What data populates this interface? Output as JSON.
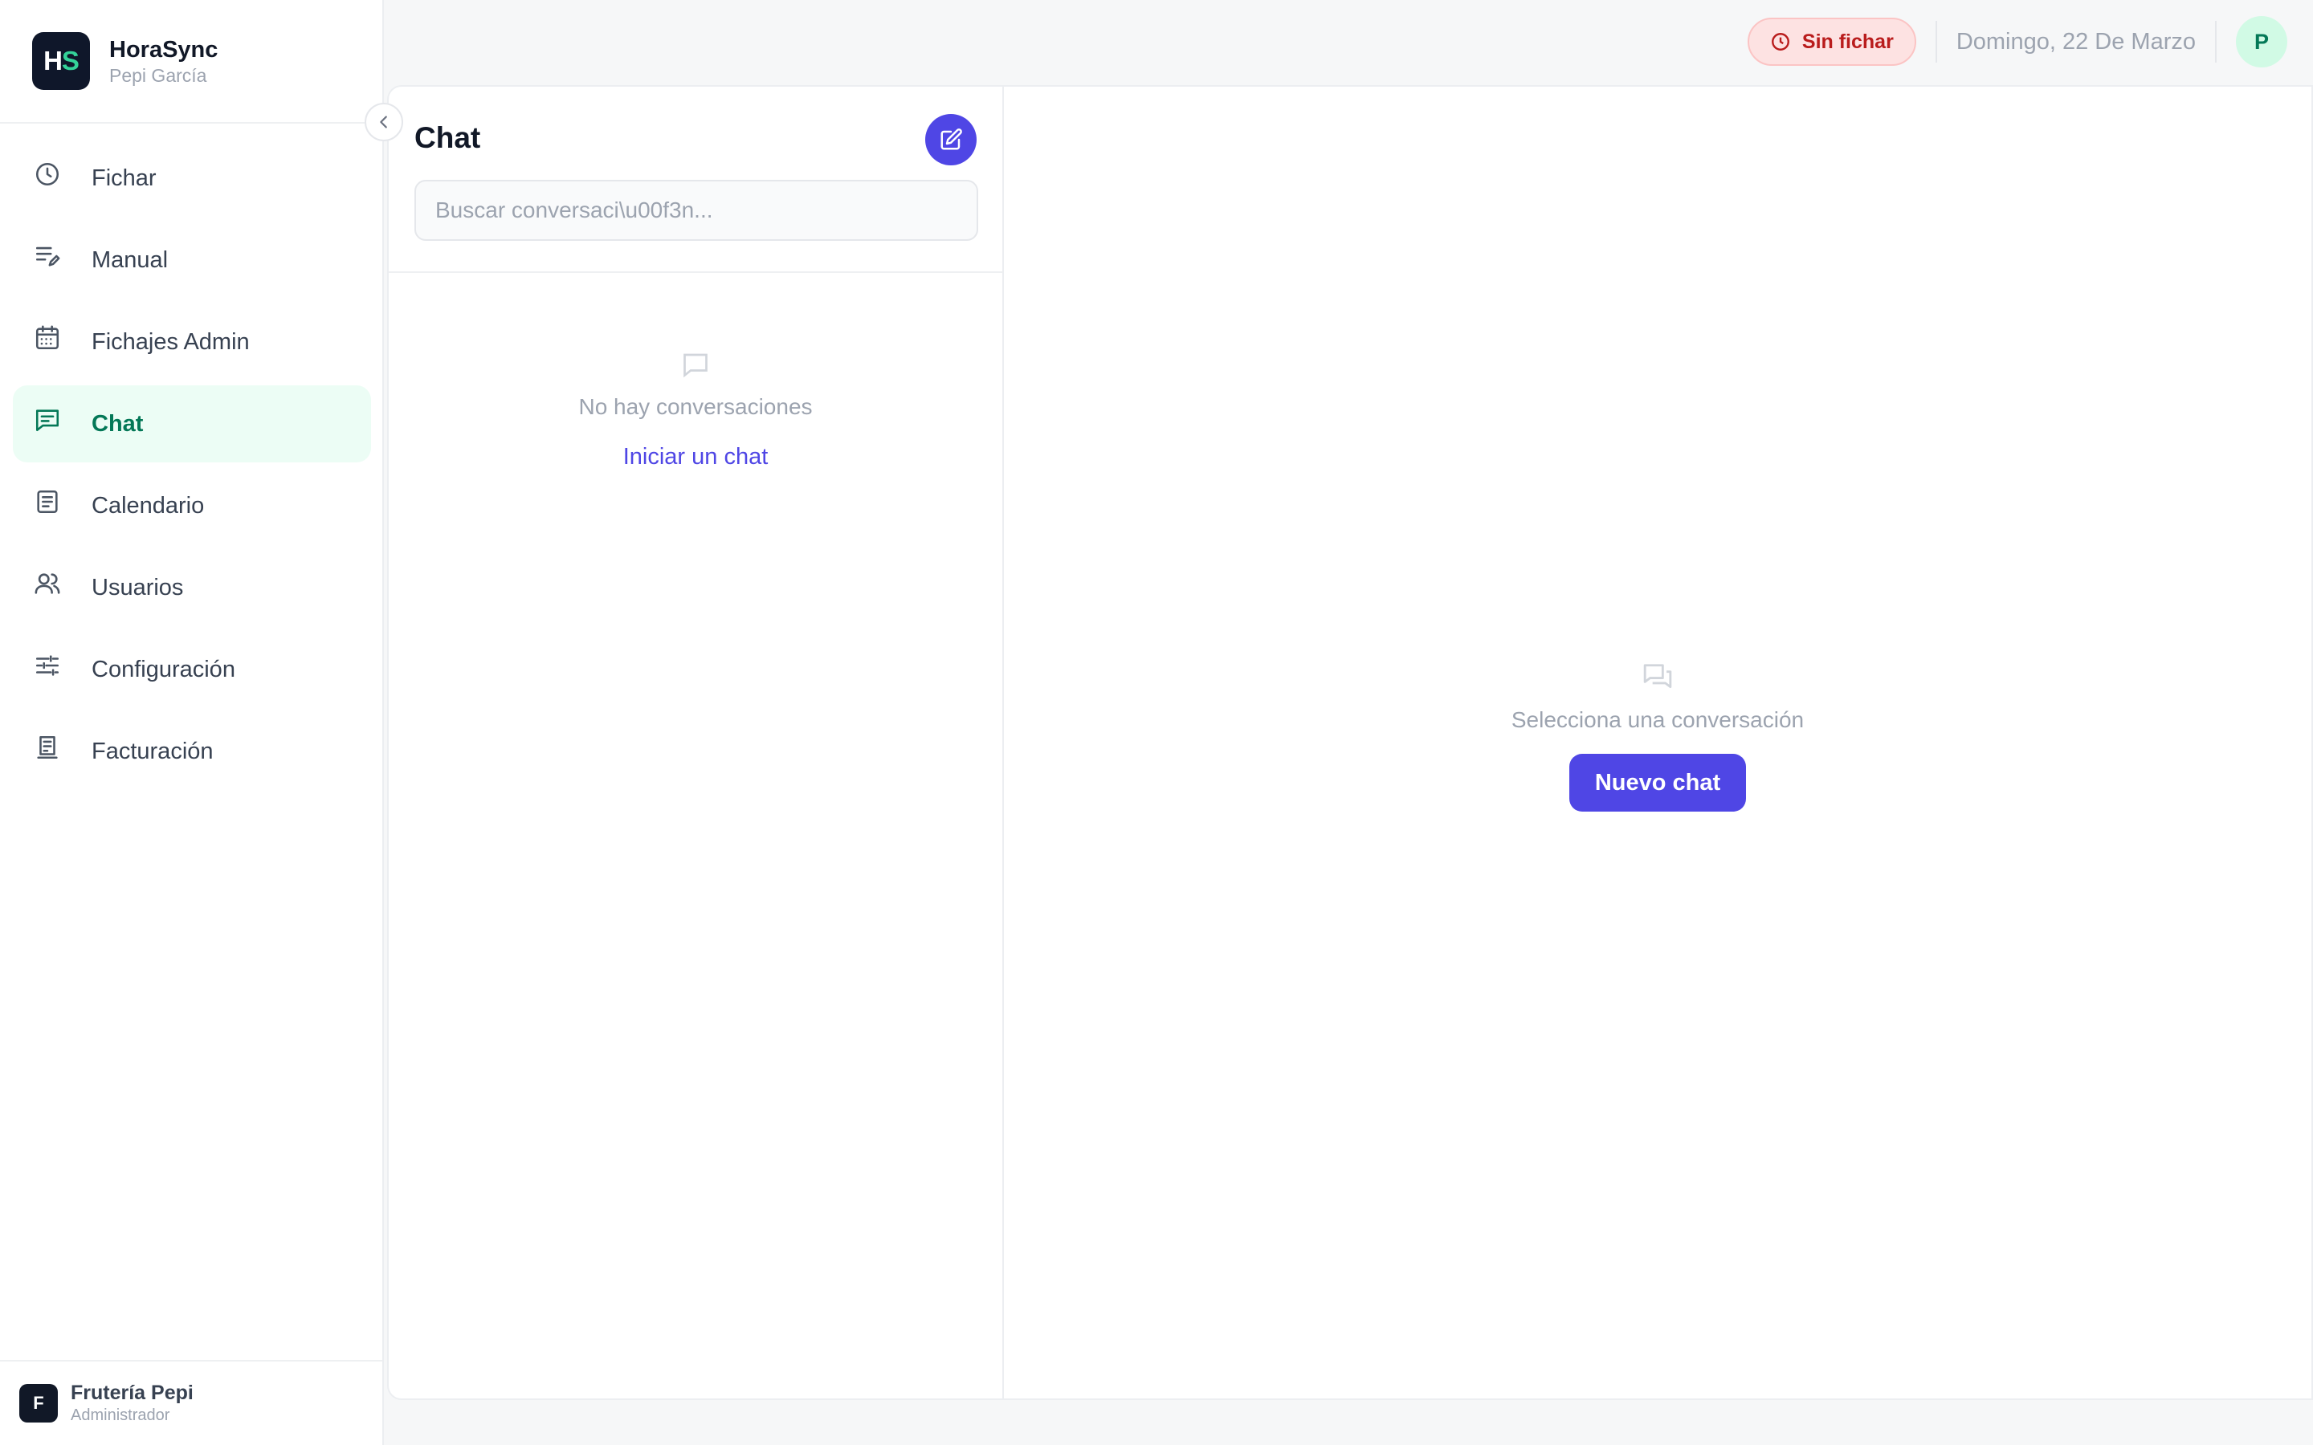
{
  "brand": {
    "logo_h": "H",
    "logo_s": "S",
    "name": "HoraSync",
    "user": "Pepi García"
  },
  "sidebar": {
    "items": [
      {
        "label": "Fichar",
        "icon": "clock-icon"
      },
      {
        "label": "Manual",
        "icon": "list-edit-icon"
      },
      {
        "label": "Fichajes Admin",
        "icon": "calendar-grid-icon"
      },
      {
        "label": "Chat",
        "icon": "message-icon",
        "active": true
      },
      {
        "label": "Calendario",
        "icon": "document-list-icon"
      },
      {
        "label": "Usuarios",
        "icon": "users-icon"
      },
      {
        "label": "Configuración",
        "icon": "sliders-icon"
      },
      {
        "label": "Facturación",
        "icon": "receipt-icon"
      }
    ],
    "footer": {
      "avatar_letter": "F",
      "org_name": "Frutería Pepi",
      "org_role": "Administrador"
    }
  },
  "topbar": {
    "status": "Sin fichar",
    "date": "Domingo, 22 De Marzo",
    "avatar_letter": "P"
  },
  "conversations": {
    "title": "Chat",
    "search_placeholder": "Buscar conversaci\\u00f3n...",
    "empty_text": "No hay conversaciones",
    "start_link": "Iniciar un chat"
  },
  "thread": {
    "empty_text": "Selecciona una conversación",
    "new_chat_button": "Nuevo chat"
  },
  "colors": {
    "accent": "#4f46e5",
    "active_nav_bg": "#ecfdf5",
    "active_nav_text": "#047857",
    "status_bg": "#fde2e2",
    "status_text": "#b91c1c"
  }
}
